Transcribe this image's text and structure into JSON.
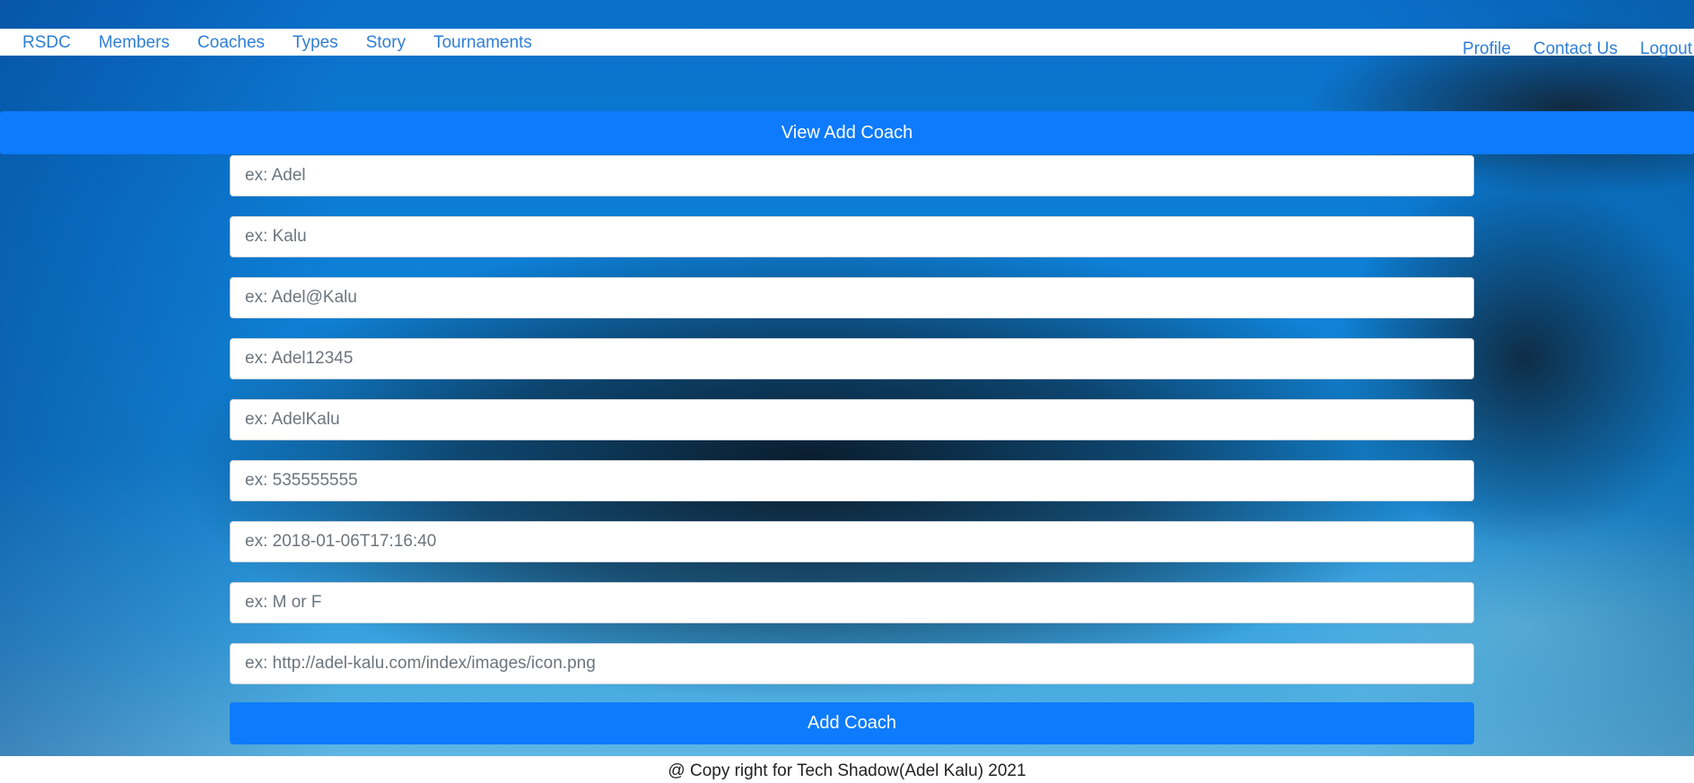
{
  "nav": {
    "brand": "RSDC",
    "left_links": [
      "Members",
      "Coaches",
      "Types",
      "Story",
      "Tournaments"
    ],
    "right_links": [
      "Profile",
      "Contact Us",
      "Logout"
    ]
  },
  "form": {
    "header": "View Add Coach",
    "fields": [
      {
        "placeholder": "ex: Adel",
        "value": ""
      },
      {
        "placeholder": "ex: Kalu",
        "value": ""
      },
      {
        "placeholder": "ex: Adel@Kalu",
        "value": ""
      },
      {
        "placeholder": "ex: Adel12345",
        "value": ""
      },
      {
        "placeholder": "ex: AdelKalu",
        "value": ""
      },
      {
        "placeholder": "ex: 535555555",
        "value": ""
      },
      {
        "placeholder": "ex: 2018-01-06T17:16:40",
        "value": ""
      },
      {
        "placeholder": "ex: M or F",
        "value": ""
      },
      {
        "placeholder": "ex: http://adel-kalu.com/index/images/icon.png",
        "value": ""
      }
    ],
    "submit_label": "Add Coach"
  },
  "footer": {
    "text": "@ Copy right for Tech Shadow(Adel Kalu) 2021"
  },
  "colors": {
    "primary": "#0d7bfc",
    "link": "#2f7fd6"
  }
}
